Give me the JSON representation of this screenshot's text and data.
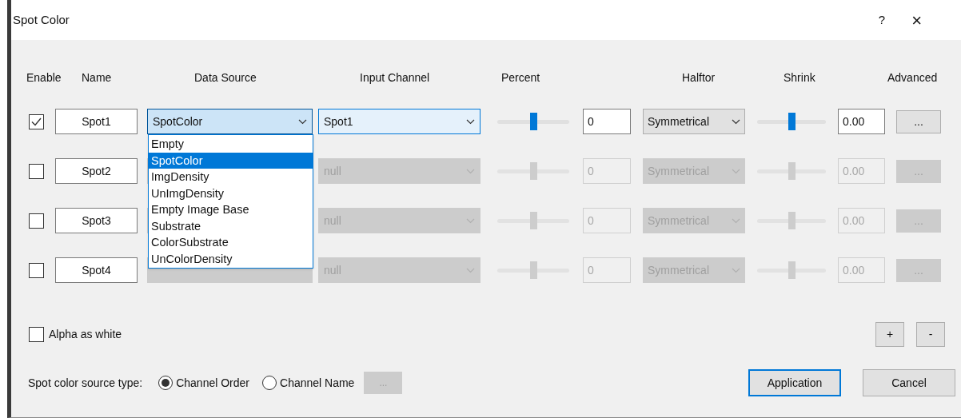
{
  "window": {
    "title": "Spot Color",
    "help": "?",
    "close": "×"
  },
  "columns": [
    "Enable",
    "Name",
    "Data Source",
    "Input Channel",
    "Percent",
    "Halftor",
    "Shrink",
    "Advanced"
  ],
  "rows": [
    {
      "checked": true,
      "disabled": false,
      "name": "Spot1",
      "data_source": {
        "value": "SpotColor",
        "open": true,
        "items": [
          {
            "label": "Empty",
            "selected": false
          },
          {
            "label": "SpotColor",
            "selected": true
          },
          {
            "label": "ImgDensity",
            "selected": false
          },
          {
            "label": "UnImgDensity",
            "selected": false
          },
          {
            "label": "Empty Image Base",
            "selected": false
          },
          {
            "label": "Substrate",
            "selected": false
          },
          {
            "label": "ColorSubstrate",
            "selected": false
          },
          {
            "label": "UnColorDensity",
            "selected": false
          }
        ]
      },
      "input_channel": "Spot1",
      "percent": {
        "level": 0.5,
        "value": "0"
      },
      "halftone": "Symmetrical",
      "shrink": {
        "level": 0.5,
        "value": "0.00"
      },
      "advanced": "..."
    },
    {
      "checked": false,
      "disabled": true,
      "name": "Spot2",
      "input_channel": "null",
      "percent": {
        "level": 0.5,
        "value": "0"
      },
      "halftone": "Symmetrical",
      "shrink": {
        "level": 0.5,
        "value": "0.00"
      },
      "advanced": "..."
    },
    {
      "checked": false,
      "disabled": true,
      "name": "Spot3",
      "input_channel": "null",
      "percent": {
        "level": 0.5,
        "value": "0"
      },
      "halftone": "Symmetrical",
      "shrink": {
        "level": 0.5,
        "value": "0.00"
      },
      "advanced": "..."
    },
    {
      "checked": false,
      "disabled": true,
      "name": "Spot4",
      "input_channel": "null",
      "percent": {
        "level": 0.5,
        "value": "0"
      },
      "halftone": "Symmetrical",
      "shrink": {
        "level": 0.5,
        "value": "0.00"
      },
      "advanced": "..."
    }
  ],
  "alpha_as_white": {
    "label": "Alpha as white",
    "checked": false
  },
  "source_type": {
    "label": "Spot color source type:",
    "options": [
      {
        "label": "Channel Order",
        "selected": true
      },
      {
        "label": "Channel Name",
        "selected": false
      }
    ],
    "browse": {
      "label": "...",
      "disabled": true
    }
  },
  "add_button": "+",
  "remove_button": "-",
  "buttons": [
    {
      "label": "Application",
      "default": true
    },
    {
      "label": "Cancel",
      "default": false
    }
  ]
}
